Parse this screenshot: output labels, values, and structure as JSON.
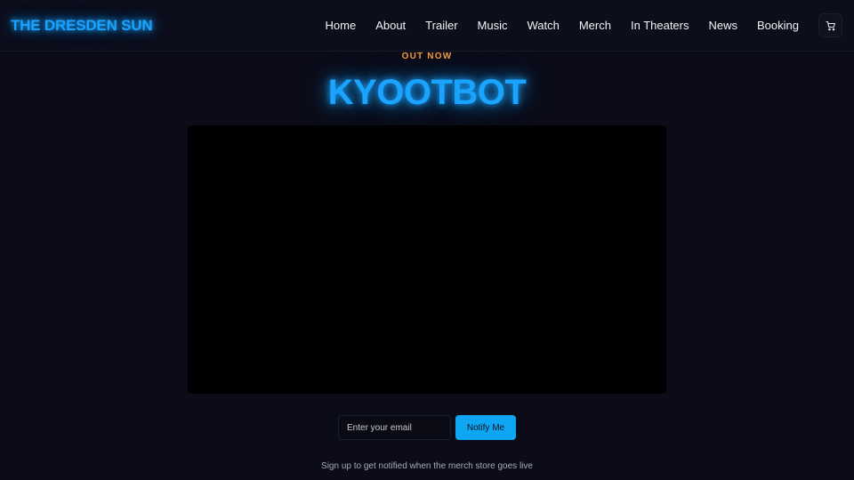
{
  "site": {
    "logo": "THE DRESDEN SUN"
  },
  "nav": {
    "items": [
      {
        "label": "Home"
      },
      {
        "label": "About"
      },
      {
        "label": "Trailer"
      },
      {
        "label": "Music"
      },
      {
        "label": "Watch"
      },
      {
        "label": "Merch"
      },
      {
        "label": "In Theaters"
      },
      {
        "label": "News"
      },
      {
        "label": "Booking"
      }
    ],
    "cart_icon": "shopping-cart-icon"
  },
  "hero": {
    "eyebrow": "OUT NOW",
    "title": "KYOOTBOT"
  },
  "signup": {
    "email_placeholder": "Enter your email",
    "email_value": "",
    "button_label": "Notify Me",
    "note": "Sign up to get notified when the merch store goes live"
  },
  "colors": {
    "accent": "#1aa3ff",
    "eyebrow": "#f59b3c",
    "button": "#0ea5f2",
    "background": "#0b0c18"
  }
}
